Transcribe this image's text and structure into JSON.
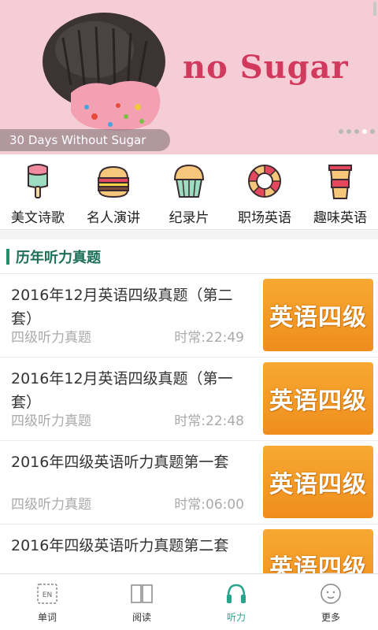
{
  "banner": {
    "brand_text": "no Sugar",
    "caption": "30 Days Without Sugar",
    "dots": 5,
    "active_dot": 3
  },
  "categories": [
    {
      "label": "美文诗歌",
      "icon": "popsicle-icon"
    },
    {
      "label": "名人演讲",
      "icon": "burger-icon"
    },
    {
      "label": "纪录片",
      "icon": "cupcake-icon"
    },
    {
      "label": "职场英语",
      "icon": "lifebuoy-icon"
    },
    {
      "label": "趣味英语",
      "icon": "drink-cup-icon"
    }
  ],
  "section": {
    "title": "历年听力真题"
  },
  "items": [
    {
      "title": "2016年12月英语四级真题（第二套）",
      "category": "四级听力真题",
      "duration": "时常:22:49",
      "thumb_text": "英语四级"
    },
    {
      "title": "2016年12月英语四级真题（第一套）",
      "category": "四级听力真题",
      "duration": "时常:22:48",
      "thumb_text": "英语四级"
    },
    {
      "title": "2016年四级英语听力真题第一套",
      "category": "四级听力真题",
      "duration": "时常:06:00",
      "thumb_text": "英语四级"
    },
    {
      "title": "2016年四级英语听力真题第二套",
      "category": "",
      "duration": "",
      "thumb_text": "英语四级"
    }
  ],
  "nav": {
    "items": [
      {
        "label": "单词",
        "icon": "en-card-icon"
      },
      {
        "label": "阅读",
        "icon": "book-icon"
      },
      {
        "label": "听力",
        "icon": "headphones-icon",
        "active": true
      },
      {
        "label": "更多",
        "icon": "smiley-icon"
      }
    ]
  },
  "colors": {
    "accent": "#26a58c",
    "section_title": "#1e6f57",
    "banner_bg": "#f5cdd6",
    "thumb": "#f39c23"
  }
}
